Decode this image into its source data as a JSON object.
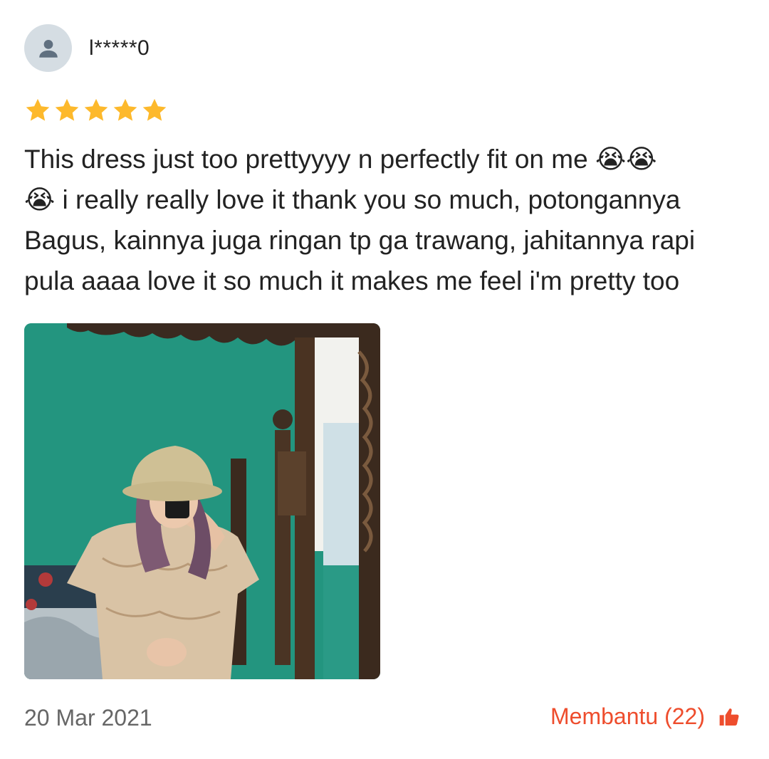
{
  "review": {
    "username": "l*****0",
    "rating": 5,
    "rating_max": 5,
    "text": "This dress just too prettyyyy n perfectly fit on me 😭😭\n😭 i really really love it thank you so much, potongannya\nBagus, kainnya juga ringan tp ga trawang, jahitannya rapi\npula aaaa love it so much it makes me feel i'm pretty too",
    "photo_icon": "review-photo",
    "date": "20 Mar 2021",
    "helpful_label": "Membantu (22)",
    "helpful_icon": "thumbs-up-icon"
  },
  "colors": {
    "star": "#fdb92c",
    "accent": "#ee4d2d",
    "avatar_bg": "#d5dde3",
    "avatar_fg": "#607080"
  }
}
